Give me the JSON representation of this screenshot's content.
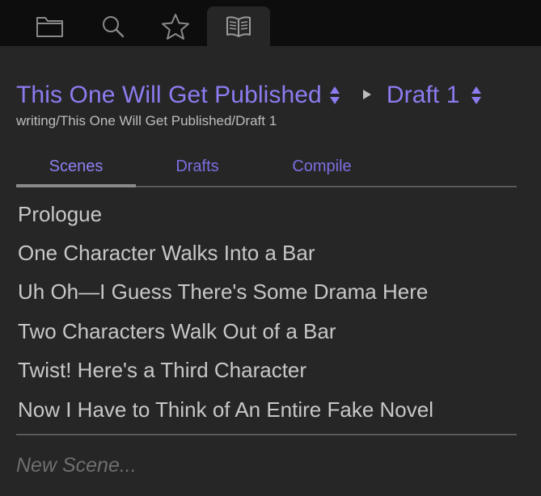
{
  "colors": {
    "background": "#262626",
    "topbar": "#0d0d0d",
    "accent": "#8b7cf0",
    "text": "#c7c7c7",
    "divider": "#5a5a5a"
  },
  "toolbar": {
    "tabs": [
      {
        "icon": "folder-icon",
        "active": false
      },
      {
        "icon": "search-icon",
        "active": false
      },
      {
        "icon": "star-icon",
        "active": false
      },
      {
        "icon": "book-icon",
        "active": true
      }
    ]
  },
  "header": {
    "project_title": "This One Will Get Published",
    "draft_title": "Draft 1",
    "path": "writing/This One Will Get Published/Draft 1"
  },
  "tabs": [
    {
      "label": "Scenes",
      "active": true
    },
    {
      "label": "Drafts",
      "active": false
    },
    {
      "label": "Compile",
      "active": false
    }
  ],
  "scenes": [
    "Prologue",
    "One Character Walks Into a Bar",
    "Uh Oh—I Guess There's Some Drama Here",
    "Two Characters Walk Out of a Bar",
    "Twist! Here's a Third Character",
    "Now I Have to Think of An Entire Fake Novel"
  ],
  "new_scene": {
    "placeholder": "New Scene...",
    "value": ""
  }
}
